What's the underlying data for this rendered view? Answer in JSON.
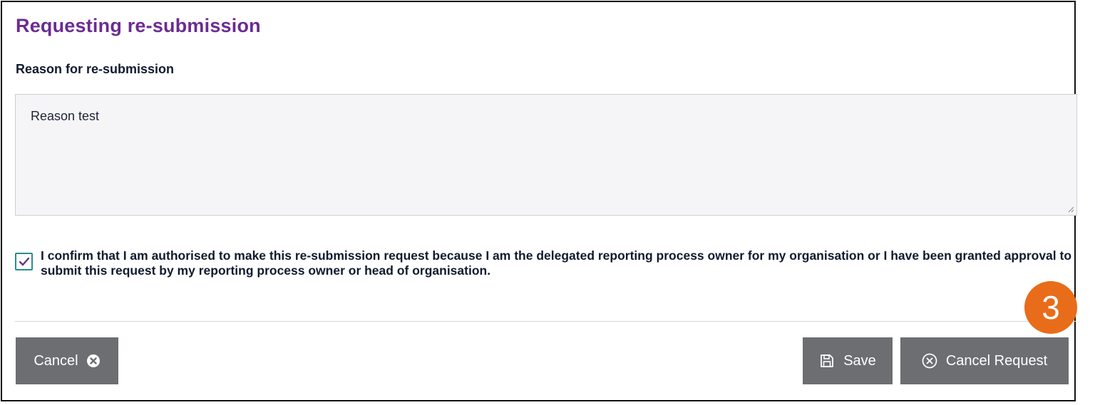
{
  "dialog": {
    "title": "Requesting re-submission",
    "reason_label": "Reason for re-submission",
    "reason_value": "Reason test",
    "confirm_checked": true,
    "confirm_text": "I confirm that I am authorised to make this re-submission request because I am the delegated reporting process owner for my organisation or I have been granted approval to submit this request by my reporting process owner or head of organisation."
  },
  "buttons": {
    "cancel_label": "Cancel",
    "save_label": "Save",
    "cancel_request_label": "Cancel Request"
  },
  "annotation": {
    "step_number": "3"
  },
  "colors": {
    "title": "#6b2c91",
    "button_bg": "#6d6e71",
    "checkbox_border": "#2c8d8d",
    "checkmark": "#6b2c91",
    "badge": "#e86c1a"
  },
  "icons": {
    "cancel": "close-circle-filled-icon",
    "save": "save-floppy-icon",
    "cancel_request": "close-circle-outline-icon",
    "confirm": "checkmark-icon"
  }
}
